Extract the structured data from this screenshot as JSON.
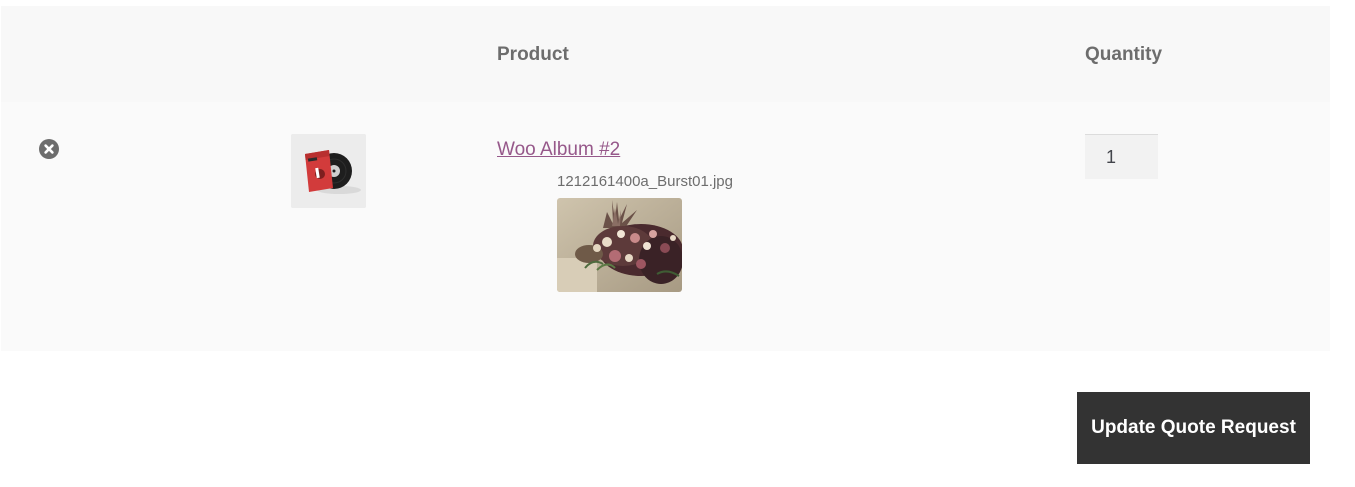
{
  "table": {
    "headers": {
      "product": "Product",
      "quantity": "Quantity"
    },
    "rows": [
      {
        "remove_icon": "remove-circle-icon",
        "thumbnail": "album-cover-thumbnail",
        "product_name": "Woo Album #2",
        "attachment_filename": "1212161400a_Burst01.jpg",
        "attachment_preview": "flower-arrangement-photo",
        "quantity": "1"
      }
    ]
  },
  "actions": {
    "update_label": "Update Quote Request"
  },
  "colors": {
    "header_bg": "#f8f8f8",
    "row_bg": "#fafafa",
    "link": "#96588a",
    "button_bg": "#333333",
    "button_text": "#ffffff",
    "icon_gray": "#6d6d6d"
  }
}
